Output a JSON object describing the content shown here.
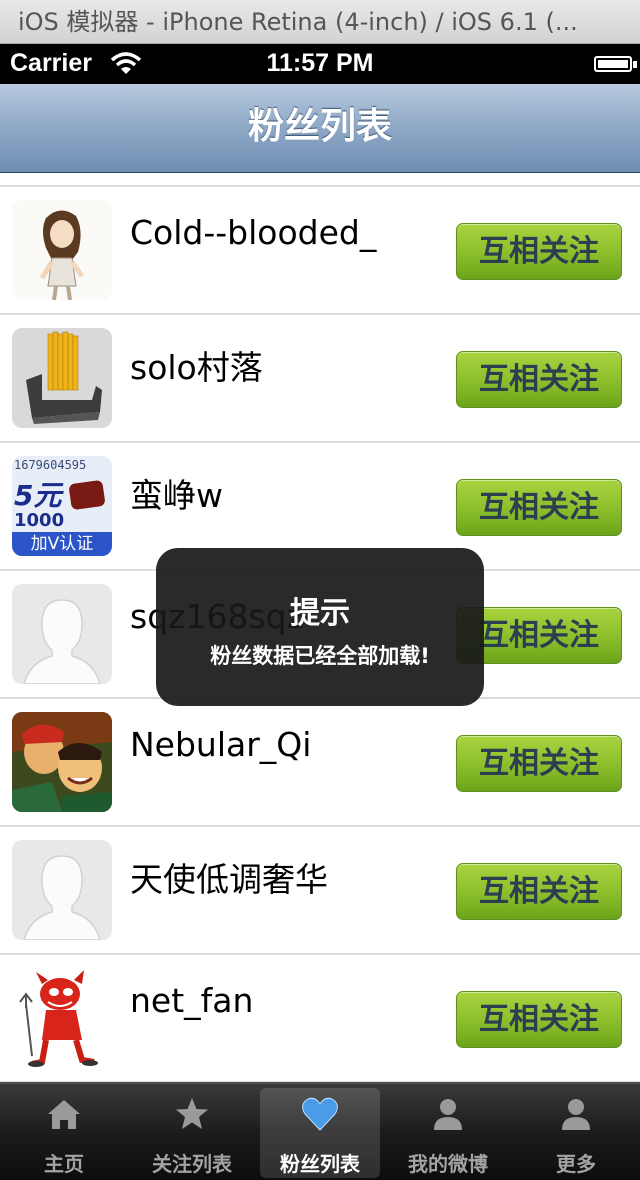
{
  "simulator": {
    "title": "iOS 模拟器 - iPhone Retina (4-inch) / iOS 6.1 (..."
  },
  "status_bar": {
    "carrier": "Carrier",
    "time": "11:57 PM"
  },
  "nav": {
    "title": "粉丝列表"
  },
  "fans": [
    {
      "name": "Cold--blooded_",
      "button": "互相关注",
      "avatar": "girl-drawing-avatar"
    },
    {
      "name": "solo村落",
      "button": "互相关注",
      "avatar": "yellow-rods-avatar"
    },
    {
      "name": "蛮峥w",
      "button": "互相关注",
      "avatar": "ad-text-avatar"
    },
    {
      "name": "sqz168sqz",
      "button": "互相关注",
      "avatar": "default-avatar"
    },
    {
      "name": "Nebular_Qi",
      "button": "互相关注",
      "avatar": "comic-characters-avatar"
    },
    {
      "name": "天使低调奢华",
      "button": "互相关注",
      "avatar": "default-avatar"
    },
    {
      "name": "net_fan",
      "button": "互相关注",
      "avatar": "red-devil-avatar"
    }
  ],
  "avatar_ad_text": {
    "line1": "1679604595",
    "line2": "5元",
    "line3": "1000",
    "line4": "加V认证"
  },
  "toast": {
    "title": "提示",
    "message": "粉丝数据已经全部加载!"
  },
  "tabs": [
    {
      "label": "主页",
      "icon": "home-icon",
      "active": false
    },
    {
      "label": "关注列表",
      "icon": "star-icon",
      "active": false
    },
    {
      "label": "粉丝列表",
      "icon": "heart-icon",
      "active": true
    },
    {
      "label": "我的微博",
      "icon": "person-icon",
      "active": false
    },
    {
      "label": "更多",
      "icon": "person-icon",
      "active": false
    }
  ],
  "colors": {
    "follow_button": "#8cc02c",
    "nav_bar": "#8ea8c6",
    "active_heart": "#4a9be8"
  }
}
